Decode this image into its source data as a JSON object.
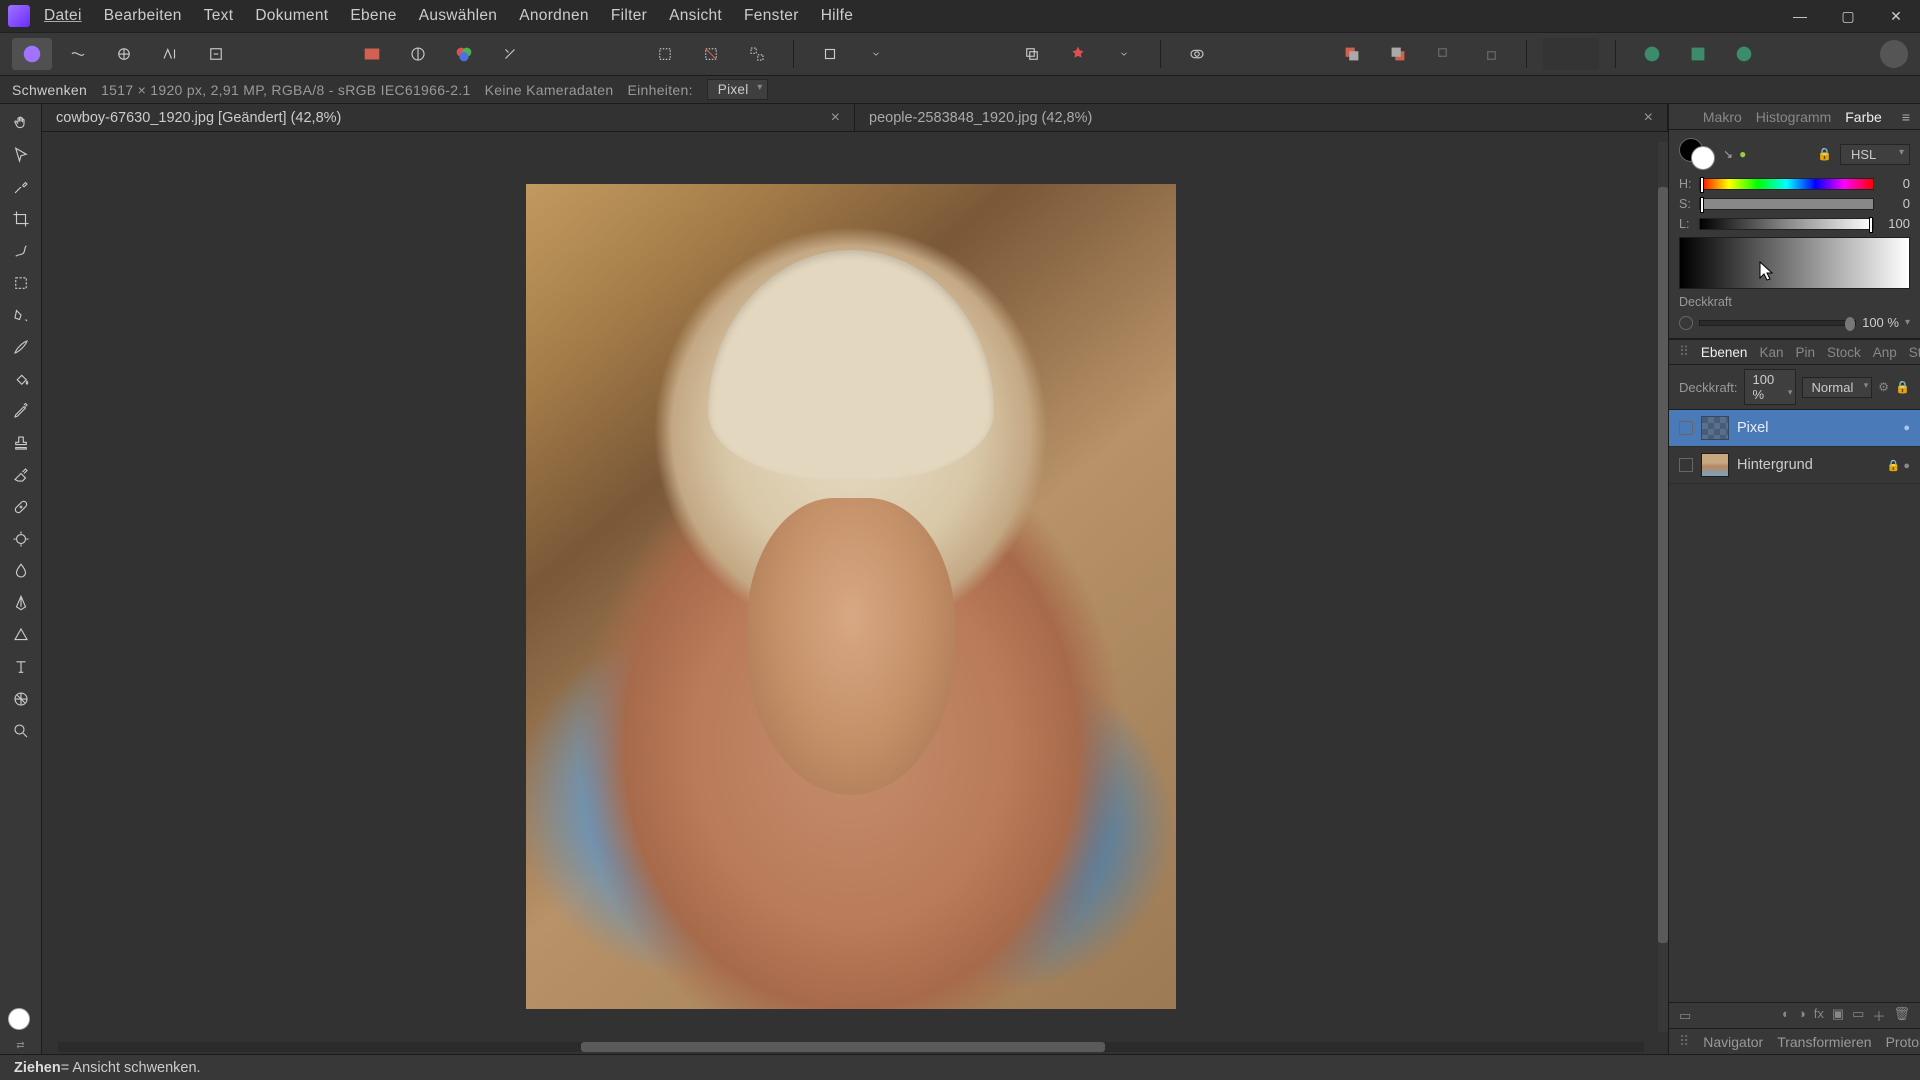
{
  "menu": {
    "file": "Datei",
    "edit": "Bearbeiten",
    "text": "Text",
    "document": "Dokument",
    "layer": "Ebene",
    "select": "Auswählen",
    "arrange": "Anordnen",
    "filter": "Filter",
    "view": "Ansicht",
    "window": "Fenster",
    "help": "Hilfe"
  },
  "context_bar": {
    "tool": "Schwenken",
    "doc_info": "1517 × 1920 px, 2,91 MP, RGBA/8 - sRGB IEC61966-2.1",
    "camera": "Keine Kameradaten",
    "units_label": "Einheiten:",
    "units_value": "Pixel"
  },
  "tabs": [
    {
      "title": "cowboy-67630_1920.jpg [Geändert] (42,8%)",
      "active": true
    },
    {
      "title": "people-2583848_1920.jpg (42,8%)",
      "active": false
    }
  ],
  "panel_tabs_top": {
    "macro": "Makro",
    "histogram": "Histogramm",
    "color": "Farbe"
  },
  "color_panel": {
    "mode": "HSL",
    "h_label": "H:",
    "s_label": "S:",
    "l_label": "L:",
    "h": "0",
    "s": "0",
    "l": "100",
    "opacity_label": "Deckkraft",
    "opacity_value": "100 %"
  },
  "layers_tabs": {
    "layers": "Ebenen",
    "kan": "Kan",
    "pin": "Pin",
    "stock": "Stock",
    "adj": "Anp",
    "styles": "Stile"
  },
  "layer_opts": {
    "opacity_label": "Deckkraft:",
    "opacity_value": "100 %",
    "blend": "Normal"
  },
  "layers": [
    {
      "name": "Pixel",
      "selected": true
    },
    {
      "name": "Hintergrund",
      "selected": false
    }
  ],
  "bottom_tabs": {
    "navigator": "Navigator",
    "transform": "Transformieren",
    "protocol": "Protokoll"
  },
  "status": {
    "left_strong": "Ziehen",
    "left_rest": " = Ansicht schwenken."
  }
}
